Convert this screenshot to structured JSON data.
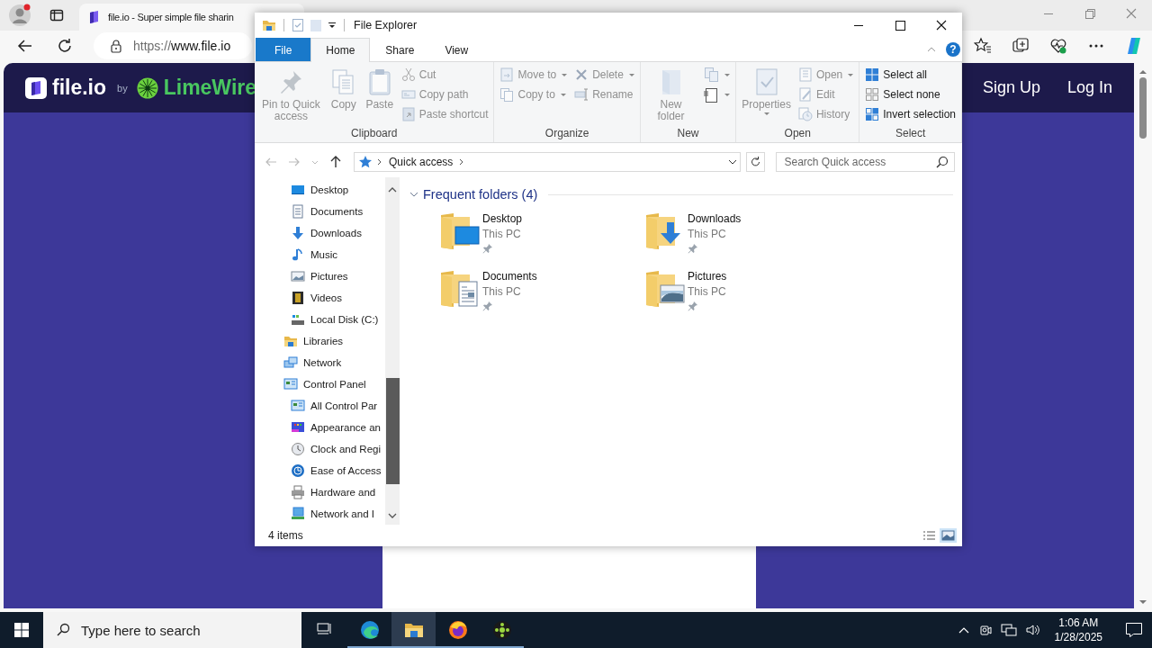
{
  "browser": {
    "tab_title": "file.io - Super simple file sharin",
    "address": {
      "scheme": "https://",
      "host": "www.file.io"
    }
  },
  "site": {
    "logo": "file.io",
    "by": "by",
    "partner": "LimeWire",
    "nav": [
      "Sign Up",
      "Log In"
    ]
  },
  "explorer": {
    "title": "File Explorer",
    "help": "?",
    "ribbon_tabs": [
      {
        "label": "File",
        "kind": "menu",
        "selected": false
      },
      {
        "label": "Home",
        "kind": "tab",
        "selected": true
      },
      {
        "label": "Share",
        "kind": "tab",
        "selected": false
      },
      {
        "label": "View",
        "kind": "tab",
        "selected": false
      }
    ],
    "groups": [
      {
        "label": "Clipboard",
        "columns": [
          [
            {
              "label": "Pin to Quick access",
              "kind": "large",
              "disabled": true
            }
          ],
          [
            {
              "label": "Copy",
              "kind": "large",
              "disabled": true
            }
          ],
          [
            {
              "label": "Paste",
              "kind": "large",
              "disabled": true
            }
          ],
          [
            {
              "label": "Cut",
              "kind": "small",
              "disabled": true
            },
            {
              "label": "Copy path",
              "kind": "small",
              "disabled": true
            },
            {
              "label": "Paste shortcut",
              "kind": "small",
              "disabled": true
            }
          ]
        ]
      },
      {
        "label": "Organize",
        "columns": [
          [
            {
              "label": "Move to",
              "kind": "small",
              "disabled": true,
              "menu": true
            },
            {
              "label": "Copy to",
              "kind": "small",
              "disabled": true,
              "menu": true
            }
          ],
          [
            {
              "label": "Delete",
              "kind": "small",
              "disabled": true,
              "menu": true
            },
            {
              "label": "Rename",
              "kind": "small",
              "disabled": true
            }
          ]
        ]
      },
      {
        "label": "New",
        "columns": [
          [
            {
              "label": "New folder",
              "kind": "large",
              "disabled": true
            }
          ],
          [
            {
              "kind": "icon",
              "disabled": true,
              "menu": true
            },
            {
              "kind": "icon",
              "disabled": false,
              "menu": true
            }
          ]
        ]
      },
      {
        "label": "Open",
        "columns": [
          [
            {
              "label": "Properties",
              "kind": "large",
              "disabled": true,
              "menu": true
            }
          ],
          [
            {
              "label": "Open",
              "kind": "small",
              "disabled": true,
              "menu": true
            },
            {
              "label": "Edit",
              "kind": "small",
              "disabled": true
            },
            {
              "label": "History",
              "kind": "small",
              "disabled": true
            }
          ]
        ]
      },
      {
        "label": "Select",
        "columns": [
          [
            {
              "label": "Select all",
              "kind": "small",
              "disabled": false
            },
            {
              "label": "Select none",
              "kind": "small",
              "disabled": false
            },
            {
              "label": "Invert selection",
              "kind": "small",
              "disabled": false
            }
          ]
        ]
      }
    ],
    "address": {
      "location": "Quick access",
      "search_placeholder": "Search Quick access"
    },
    "nav": {
      "continued_children": [
        {
          "label": "Desktop"
        },
        {
          "label": "Documents"
        },
        {
          "label": "Downloads"
        },
        {
          "label": "Music"
        },
        {
          "label": "Pictures"
        },
        {
          "label": "Videos"
        },
        {
          "label": "Local Disk (C:)"
        }
      ],
      "items": [
        {
          "label": "Libraries"
        },
        {
          "label": "Network"
        },
        {
          "label": "Control Panel",
          "children": [
            {
              "label": "All Control Par"
            },
            {
              "label": "Appearance an"
            },
            {
              "label": "Clock and Regi"
            },
            {
              "label": "Ease of Access"
            },
            {
              "label": "Hardware and"
            },
            {
              "label": "Network and I"
            }
          ]
        }
      ]
    },
    "group": {
      "label": "Frequent folders (4)",
      "expanded": true,
      "folders": [
        {
          "name": "Desktop",
          "location": "This PC",
          "pinned": true
        },
        {
          "name": "Downloads",
          "location": "This PC",
          "pinned": true
        },
        {
          "name": "Documents",
          "location": "This PC",
          "pinned": true
        },
        {
          "name": "Pictures",
          "location": "This PC",
          "pinned": true
        }
      ]
    },
    "status": "4 items",
    "views": [
      {
        "kind": "details",
        "selected": false
      },
      {
        "kind": "tiles",
        "selected": true
      }
    ]
  },
  "taskbar": {
    "search_placeholder": "Type here to search",
    "apps": [
      {
        "selected": false
      },
      {
        "selected": false
      },
      {
        "selected": true
      },
      {
        "selected": false
      },
      {
        "selected": false
      }
    ],
    "time": "1:06 AM",
    "date": "1/28/2025"
  }
}
